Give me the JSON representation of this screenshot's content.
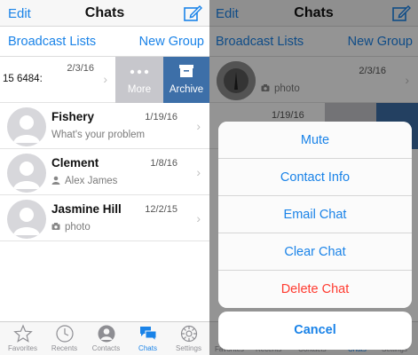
{
  "colors": {
    "accent": "#1a83e8",
    "destructive": "#ff3b30",
    "archive": "#3d6fa8",
    "more": "#c7c7cc"
  },
  "left": {
    "navbar": {
      "edit": "Edit",
      "title": "Chats",
      "compose_icon": "compose-icon"
    },
    "actionbar": {
      "broadcast": "Broadcast Lists",
      "new_group": "New Group"
    },
    "swiped_row": {
      "snippet": "15 6484:",
      "date": "2/3/16"
    },
    "swipe_actions": {
      "more": "More",
      "archive": "Archive"
    },
    "chats": [
      {
        "name": "Fishery",
        "date": "1/19/16",
        "snippet": "What's your problem",
        "icon": ""
      },
      {
        "name": "Clement",
        "date": "1/8/16",
        "snippet": "Alex James",
        "icon": "person-icon"
      },
      {
        "name": "Jasmine Hill",
        "date": "12/2/15",
        "snippet": "photo",
        "icon": "camera-icon"
      }
    ],
    "tabs": [
      {
        "label": "Favorites",
        "icon": "star-icon"
      },
      {
        "label": "Recents",
        "icon": "clock-icon"
      },
      {
        "label": "Contacts",
        "icon": "contacts-icon"
      },
      {
        "label": "Chats",
        "icon": "chats-icon",
        "active": true
      },
      {
        "label": "Settings",
        "icon": "gear-icon"
      }
    ]
  },
  "right": {
    "navbar": {
      "edit": "Edit",
      "title": "Chats"
    },
    "actionbar": {
      "broadcast": "Broadcast Lists",
      "new_group": "New Group"
    },
    "row1": {
      "date": "2/3/16",
      "snippet": "photo"
    },
    "row2": {
      "date": "1/19/16"
    },
    "action_sheet": {
      "items": [
        {
          "label": "Mute",
          "destructive": false
        },
        {
          "label": "Contact Info",
          "destructive": false
        },
        {
          "label": "Email Chat",
          "destructive": false
        },
        {
          "label": "Clear Chat",
          "destructive": false
        },
        {
          "label": "Delete Chat",
          "destructive": true
        }
      ],
      "cancel": "Cancel"
    },
    "tabs": [
      "Favorites",
      "Recents",
      "Contacts",
      "Chats",
      "Settings"
    ]
  }
}
